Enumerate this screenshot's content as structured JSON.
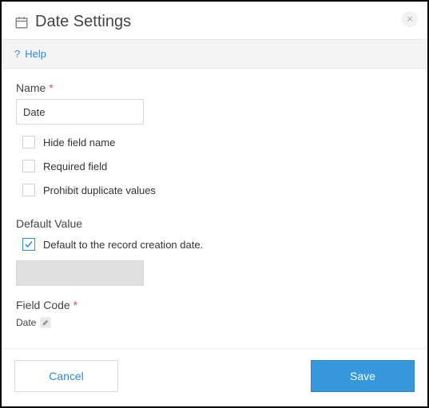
{
  "header": {
    "title": "Date Settings",
    "close_label": "×"
  },
  "help": {
    "label": "Help",
    "icon": "?"
  },
  "name": {
    "label": "Name",
    "required_mark": "*",
    "value": "Date"
  },
  "options": {
    "hide_field_name": {
      "label": "Hide field name",
      "checked": false
    },
    "required_field": {
      "label": "Required field",
      "checked": false
    },
    "prohibit_duplicate": {
      "label": "Prohibit duplicate values",
      "checked": false
    }
  },
  "default_value": {
    "label": "Default Value",
    "default_to_creation": {
      "label": "Default to the record creation date.",
      "checked": true
    },
    "value": ""
  },
  "field_code": {
    "label": "Field Code",
    "required_mark": "*",
    "value": "Date"
  },
  "footer": {
    "cancel": "Cancel",
    "save": "Save"
  }
}
